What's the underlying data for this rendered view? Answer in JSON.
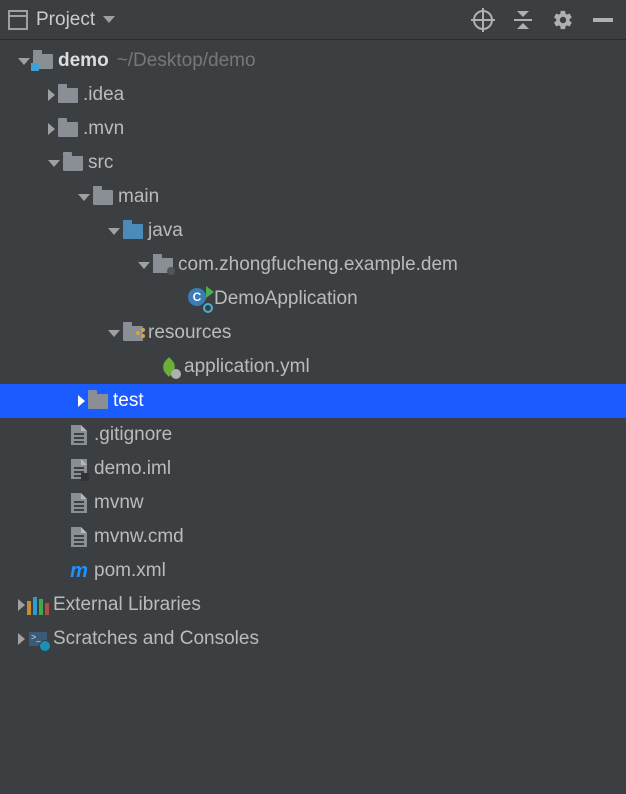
{
  "toolbar": {
    "title": "Project"
  },
  "tree": {
    "root": {
      "name": "demo",
      "path": "~/Desktop/demo"
    },
    "idea": ".idea",
    "mvn": ".mvn",
    "src": "src",
    "main": "main",
    "java": "java",
    "pkg": "com.zhongfucheng.example.dem",
    "democlass": "DemoApplication",
    "resources": "resources",
    "appyml": "application.yml",
    "test": "test",
    "gitignore": ".gitignore",
    "demoiml": "demo.iml",
    "mvnw": "mvnw",
    "mvnwcmd": "mvnw.cmd",
    "pom": "pom.xml",
    "extlibs": "External Libraries",
    "scratches": "Scratches and Consoles"
  }
}
